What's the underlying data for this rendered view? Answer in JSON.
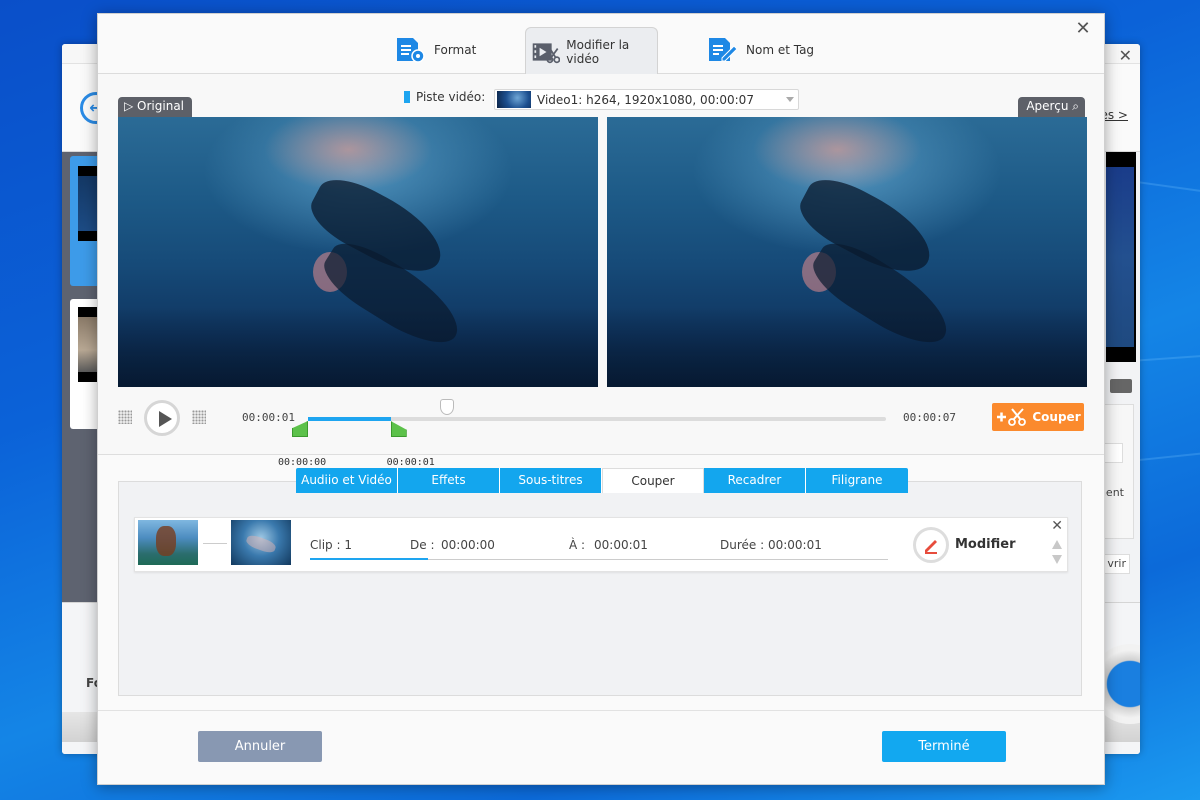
{
  "background_app": {
    "close_label": "✕",
    "link_partial": "es >",
    "partial_label_bottom": "Fo",
    "partial_text_ment": "ment",
    "partial_button_vrir": "vrir"
  },
  "dialog": {
    "close_label": "✕",
    "top_tabs": [
      {
        "label": "Format",
        "icon": "format-settings-icon",
        "active": false
      },
      {
        "label": "Modifier la vidéo",
        "icon": "video-edit-icon",
        "active": true
      },
      {
        "label": "Nom et Tag",
        "icon": "name-tag-icon",
        "active": false
      }
    ],
    "preview": {
      "original_label": "Original",
      "apercu_label": "Aperçu",
      "track_label": "Piste vidéo:",
      "track_value": "Video1: h264, 1920x1080, 00:00:07"
    },
    "player": {
      "current_time": "00:00:01",
      "end_time": "00:00:07",
      "trim_start_label": "00:00:00",
      "trim_end_label": "00:00:01",
      "selection_start_fraction": 0.0,
      "selection_end_fraction": 0.143,
      "playhead_fraction": 0.24,
      "cut_button_label": "Couper",
      "colors": {
        "selection": "#1ea5f0",
        "handle": "#5cc14a",
        "cut_button": "#fb8a2d"
      }
    },
    "edit_tabs": [
      {
        "label": "Audiio et Vidéo",
        "active": false
      },
      {
        "label": "Effets",
        "active": false
      },
      {
        "label": "Sous-titres",
        "active": false
      },
      {
        "label": "Couper",
        "active": true
      },
      {
        "label": "Recadrer",
        "active": false
      },
      {
        "label": "Filigrane",
        "active": false
      }
    ],
    "clips": [
      {
        "clip": "Clip : 1",
        "from_label": "De :",
        "from_value": "00:00:00",
        "to_label": "À :",
        "to_value": "00:00:01",
        "duration": "Durée : 00:00:01",
        "modify_label": "Modifier"
      }
    ],
    "footer": {
      "cancel_label": "Annuler",
      "done_label": "Terminé"
    }
  }
}
